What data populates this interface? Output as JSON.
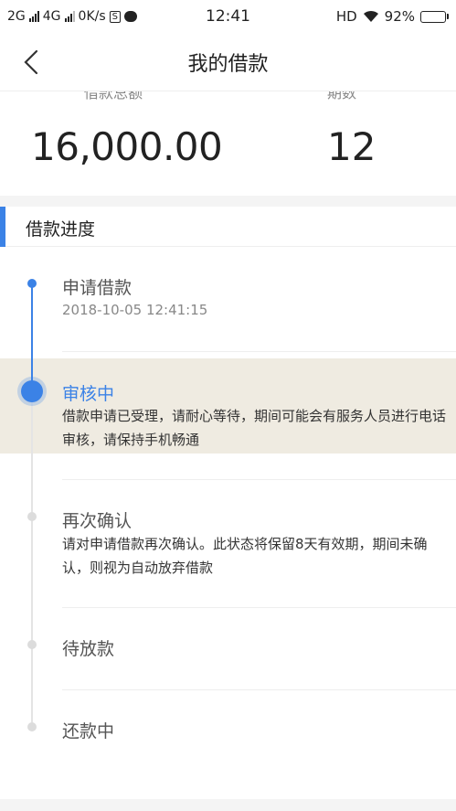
{
  "status_bar": {
    "net1": "2G",
    "net2": "4G",
    "speed": "0K/s",
    "sim_badge": "S",
    "time": "12:41",
    "hd": "HD",
    "battery": "92%",
    "battery_level": 0.92
  },
  "nav": {
    "title": "我的借款",
    "back_icon": "chevron-left-icon"
  },
  "summary": {
    "amount_label": "借款总额",
    "periods_label": "期数",
    "amount": "16,000.00",
    "periods": "12"
  },
  "progress": {
    "header": "借款进度",
    "accent_color": "#3b82e6",
    "steps": [
      {
        "title": "申请借款",
        "time": "2018-10-05 12:41:15"
      },
      {
        "title": "审核中",
        "desc": "借款申请已受理，请耐心等待，期间可能会有服务人员进行电话审核，请保持手机畅通"
      },
      {
        "title": "再次确认",
        "desc": "请对申请借款再次确认。此状态将保留8天有效期，期间未确认，则视为自动放弃借款"
      },
      {
        "title": "待放款"
      },
      {
        "title": "还款中"
      }
    ]
  }
}
